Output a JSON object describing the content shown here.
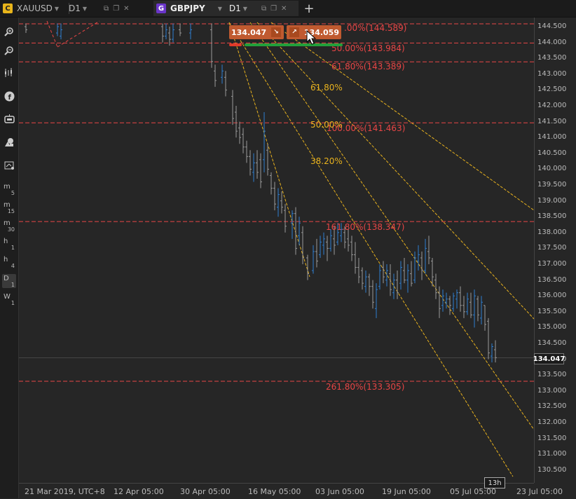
{
  "tabs": [
    {
      "badge": "C",
      "badge_color": "#e8b51b",
      "symbol": "XAUUSD",
      "timeframe": "D1"
    },
    {
      "badge": "G",
      "badge_color": "#6a35c9",
      "symbol": "GBPJPY",
      "timeframe": "D1"
    }
  ],
  "new_tab_label": "+",
  "timeframes": [
    {
      "main": "m",
      "sub": "5"
    },
    {
      "main": "m",
      "sub": "15"
    },
    {
      "main": "m",
      "sub": "30"
    },
    {
      "main": "h",
      "sub": "1"
    },
    {
      "main": "h",
      "sub": "4"
    },
    {
      "main": "D",
      "sub": "1"
    },
    {
      "main": "W",
      "sub": "1"
    }
  ],
  "tools": [
    "zoom-in-icon",
    "zoom-out-icon",
    "indicators-icon",
    "facebook-icon",
    "robot-icon",
    "shapes-icon",
    "chart-settings-icon"
  ],
  "price_axis": [
    "144.500",
    "144.000",
    "143.500",
    "143.000",
    "142.500",
    "142.000",
    "141.500",
    "141.000",
    "140.500",
    "140.000",
    "139.500",
    "139.000",
    "138.500",
    "138.000",
    "137.500",
    "137.000",
    "136.500",
    "136.000",
    "135.500",
    "135.000",
    "134.500",
    "134.000",
    "133.500",
    "133.000",
    "132.500",
    "132.000",
    "131.500",
    "131.000",
    "130.500"
  ],
  "time_axis": [
    "21 Mar 2019, UTC+8",
    "12 Apr 05:00",
    "30 Apr 05:00",
    "16 May 05:00",
    "03 Jun 05:00",
    "19 Jun 05:00",
    "05 Jul 05:00",
    "23 Jul 05:00"
  ],
  "fib_levels": [
    ".00%(144.589)",
    "50.00%(143.984)",
    "61.80%(143.389)",
    "100.00%(141.463)",
    "161.80%(138.347)",
    "261.80%(133.305)"
  ],
  "fan_levels": [
    "61.80%",
    "50.00%",
    "38.20%"
  ],
  "current_price": "134.047",
  "time_to_close": "13h",
  "order": {
    "sell_price": "134.047",
    "buy_price": "134.059"
  },
  "colors": {
    "bull": "#2f7fd0",
    "bear": "#9a9a9a",
    "fib": "#e84545",
    "fan": "#e8b21e",
    "sell": "#c05a30"
  }
}
